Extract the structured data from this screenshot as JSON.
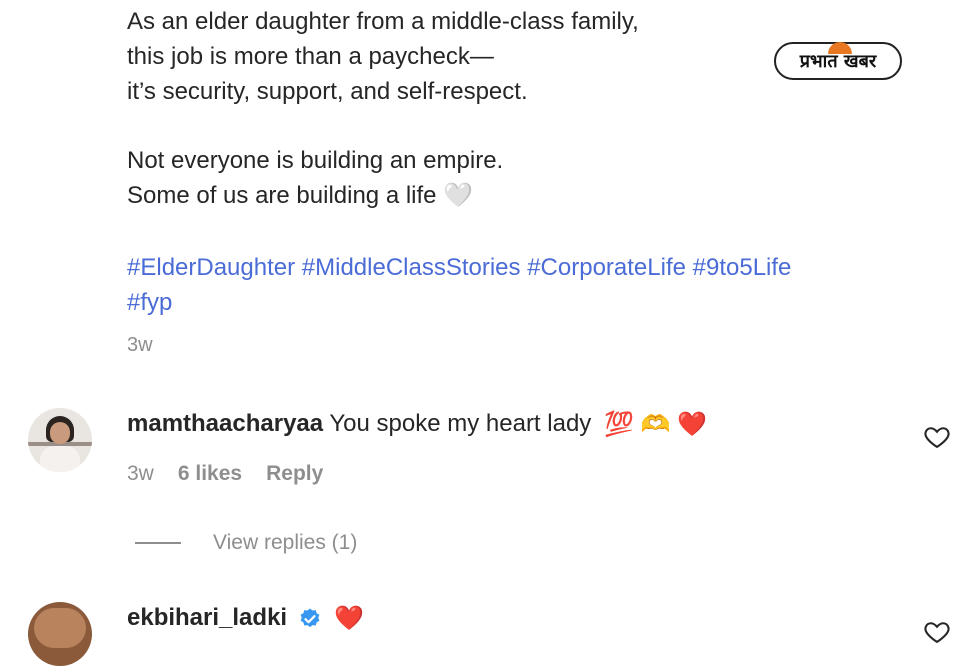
{
  "post": {
    "caption_lines": [
      "As an elder daughter from a middle-class family,",
      "this job is more than a paycheck—",
      "it’s security, support, and self-respect."
    ],
    "caption_lines_2": [
      "Not everyone is building an empire.",
      "Some of us are building a life 🤍"
    ],
    "hashtags_line1": "#ElderDaughter #MiddleClassStories #CorporateLife #9to5Life",
    "hashtags_line2": "#fyp",
    "time": "3w"
  },
  "watermark": {
    "text": "प्रभात खबर"
  },
  "comments": [
    {
      "username": "mamthaacharyaa",
      "text": "You spoke my heart lady",
      "emojis": "💯 🫶 ❤️",
      "time": "3w",
      "likes": "6 likes",
      "reply_label": "Reply",
      "view_replies": "View replies (1)"
    },
    {
      "username": "ekbihari_ladki",
      "text": "",
      "emojis": "❤️"
    }
  ],
  "colors": {
    "hashtag": "#4b6cd6",
    "muted": "#8e8e8e",
    "verified": "#3897f0",
    "heart_emoji": "#e8305a"
  }
}
